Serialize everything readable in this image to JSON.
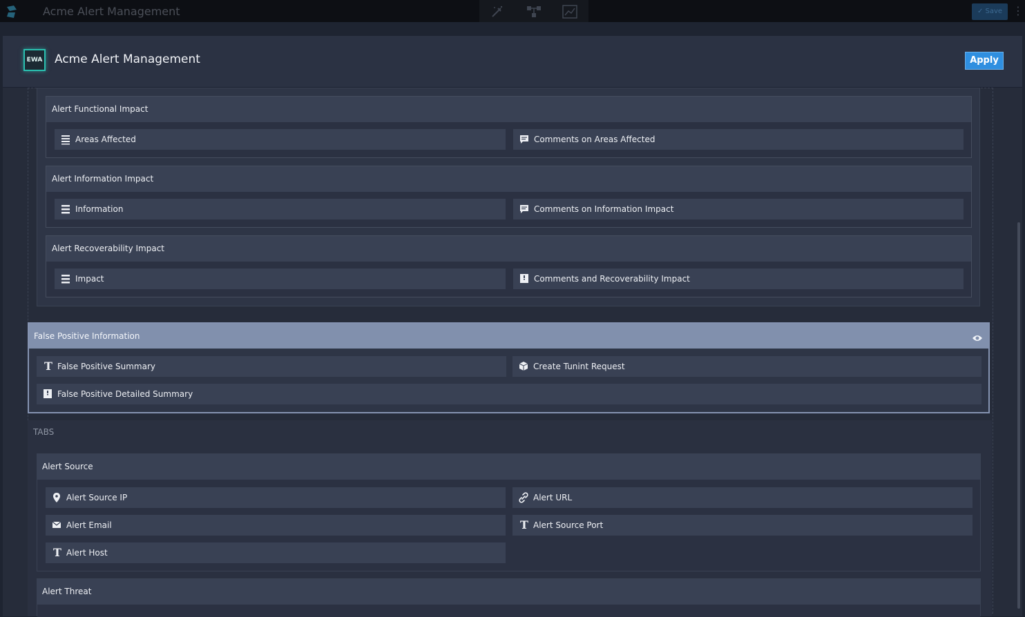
{
  "background_app": {
    "title": "Acme Alert Management",
    "save_label": "Save"
  },
  "modal": {
    "badge": "EWA",
    "title": "Acme Alert Management",
    "apply_label": "Apply"
  },
  "impact_groups": [
    {
      "title": "Alert Functional Impact",
      "fields": [
        {
          "label": "Areas Affected",
          "icon": "multi-select-icon"
        },
        {
          "label": "Comments on Areas Affected",
          "icon": "comment-icon"
        }
      ]
    },
    {
      "title": "Alert Information Impact",
      "fields": [
        {
          "label": "Information",
          "icon": "list-icon"
        },
        {
          "label": "Comments on Information Impact",
          "icon": "comment-icon"
        }
      ]
    },
    {
      "title": "Alert Recoverability Impact",
      "fields": [
        {
          "label": "Impact",
          "icon": "list-icon"
        },
        {
          "label": "Comments and Recoverability Impact",
          "icon": "rich-text-icon"
        }
      ]
    }
  ],
  "false_positive": {
    "title": "False Positive Information",
    "fields": [
      {
        "label": "False Positive Summary",
        "icon": "text-icon"
      },
      {
        "label": "Create Tunint Request",
        "icon": "cube-icon"
      },
      {
        "label": "False Positive Detailed Summary",
        "icon": "rich-text-icon"
      }
    ]
  },
  "tabs": {
    "label": "TABS",
    "alert_source": {
      "title": "Alert Source",
      "fields": [
        {
          "label": "Alert Source IP",
          "icon": "location-pin-icon"
        },
        {
          "label": "Alert URL",
          "icon": "link-icon"
        },
        {
          "label": "Alert Email",
          "icon": "envelope-icon"
        },
        {
          "label": "Alert Source Port",
          "icon": "text-icon"
        },
        {
          "label": "Alert Host",
          "icon": "text-icon"
        }
      ]
    },
    "alert_threat": {
      "title": "Alert Threat"
    }
  },
  "colors": {
    "accent": "#2f8fe0",
    "badge_border": "#2ac0b0",
    "selected_section": "#8190ad"
  }
}
